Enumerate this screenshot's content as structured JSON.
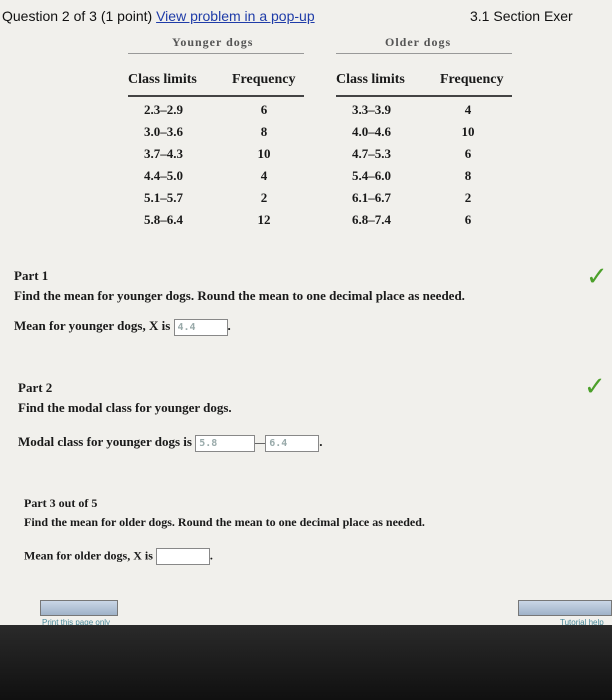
{
  "header": {
    "question_label": "Question 2 of 3 (1 point)",
    "popup_link": "View problem in a pop-up",
    "section": "3.1 Section Exer"
  },
  "table": {
    "younger_title": "Younger dogs",
    "older_title": "Older dogs",
    "col_class": "Class limits",
    "col_freq": "Frequency",
    "younger_rows": [
      {
        "cls": "2.3–2.9",
        "freq": "6"
      },
      {
        "cls": "3.0–3.6",
        "freq": "8"
      },
      {
        "cls": "3.7–4.3",
        "freq": "10"
      },
      {
        "cls": "4.4–5.0",
        "freq": "4"
      },
      {
        "cls": "5.1–5.7",
        "freq": "2"
      },
      {
        "cls": "5.8–6.4",
        "freq": "12"
      }
    ],
    "older_rows": [
      {
        "cls": "3.3–3.9",
        "freq": "4"
      },
      {
        "cls": "4.0–4.6",
        "freq": "10"
      },
      {
        "cls": "4.7–5.3",
        "freq": "6"
      },
      {
        "cls": "5.4–6.0",
        "freq": "8"
      },
      {
        "cls": "6.1–6.7",
        "freq": "2"
      },
      {
        "cls": "6.8–7.4",
        "freq": "6"
      }
    ]
  },
  "part1": {
    "title": "Part 1",
    "prompt": "Find the mean for younger dogs. Round the mean to one decimal place as needed.",
    "answer_label": "Mean for younger dogs, X is",
    "answer_value": "4.4",
    "period": "."
  },
  "part2": {
    "title": "Part 2",
    "prompt": "Find the modal class for younger dogs.",
    "answer_label": "Modal class for younger dogs is",
    "low_value": "5.8",
    "high_value": "6.4",
    "period": "."
  },
  "part3": {
    "title": "Part 3 out of 5",
    "prompt": "Find the mean for older dogs. Round the mean to one decimal place as needed.",
    "answer_label": "Mean for older dogs, X is",
    "answer_value": "",
    "period": "."
  },
  "footer": {
    "print_link": "Print this page only",
    "tutorial_link": "Tutorial help"
  },
  "colors": {
    "check": "#4ca02a",
    "link": "#1f3ca8",
    "background": "#f1f0ec"
  }
}
